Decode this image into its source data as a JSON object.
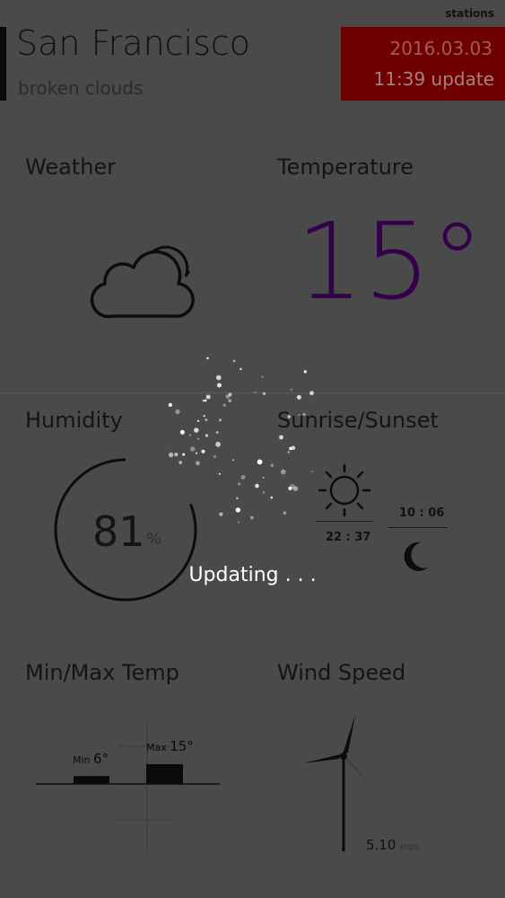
{
  "header": {
    "stations_link": "stations",
    "city": "San Francisco",
    "condition": "broken clouds",
    "update_date": "2016.03.03",
    "update_time": "11:39 update"
  },
  "tiles": {
    "weather": {
      "label": "Weather",
      "icon": "broken-clouds-icon"
    },
    "temperature": {
      "label": "Temperature",
      "value": "15°"
    },
    "humidity": {
      "label": "Humidity",
      "value": "81",
      "unit": "%",
      "percent": 81
    },
    "sun": {
      "label": "Sunrise/Sunset",
      "sunrise": "10 : 06",
      "sunset": "22 : 37",
      "icons": [
        "sun-icon",
        "moon-icon"
      ]
    },
    "minmax": {
      "label": "Min/Max Temp",
      "min_label": "Min",
      "min_value": "6°",
      "max_label": "Max",
      "max_value": "15°",
      "min": 6,
      "max": 15
    },
    "wind": {
      "label": "Wind Speed",
      "value": "5.10",
      "unit": "mps",
      "icon": "wind-turbine-icon"
    }
  },
  "overlay": {
    "text": "Updating . . ."
  },
  "colors": {
    "background": "#4a4a4a",
    "update_box": "#6e0000",
    "temperature": "#33004a",
    "overlay_text": "#ffffff"
  }
}
